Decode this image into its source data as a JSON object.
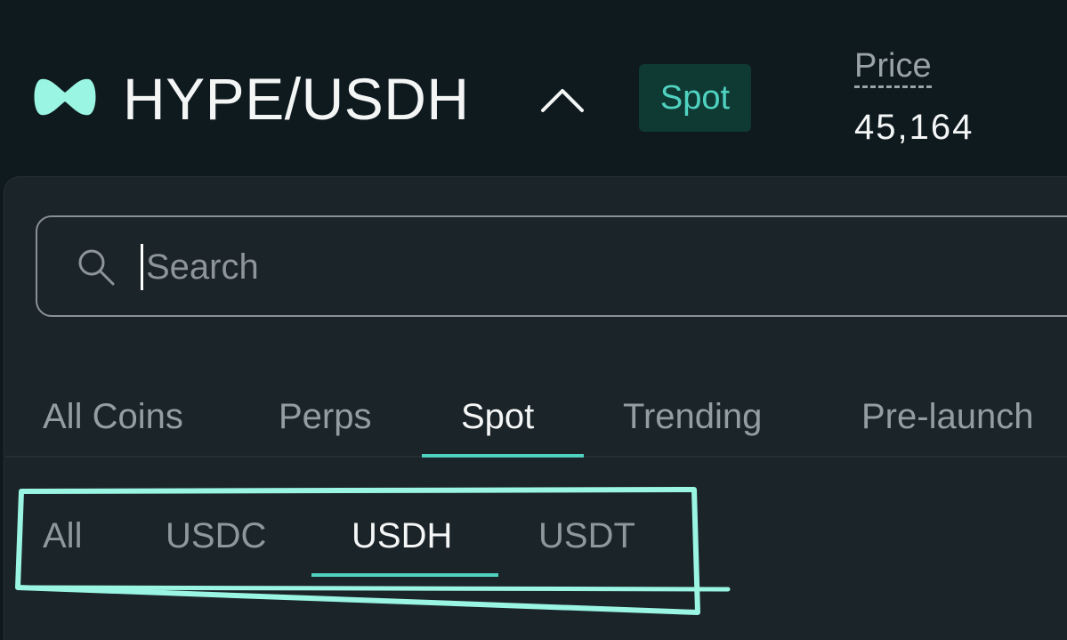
{
  "header": {
    "logo_icon": "hyperliquid-logo-icon",
    "pair": "HYPE/USDH",
    "chevron_icon": "chevron-up-icon",
    "market_badge": "Spot",
    "price_label": "Price",
    "price_value": "45,164"
  },
  "search": {
    "icon": "search-icon",
    "placeholder": "Search",
    "value": ""
  },
  "tabs": [
    {
      "label": "All Coins",
      "active": false
    },
    {
      "label": "Perps",
      "active": false
    },
    {
      "label": "Spot",
      "active": true
    },
    {
      "label": "Trending",
      "active": false
    },
    {
      "label": "Pre-launch",
      "active": false
    }
  ],
  "subtabs": [
    {
      "label": "All",
      "active": false
    },
    {
      "label": "USDC",
      "active": false
    },
    {
      "label": "USDH",
      "active": true
    },
    {
      "label": "USDT",
      "active": false
    }
  ],
  "colors": {
    "background": "#0f1a1f",
    "panel": "#1b2429",
    "accent": "#50d2c1",
    "badge_bg": "#0f3a33",
    "highlight_stroke": "#9af5e2",
    "muted_text": "#949ea2"
  }
}
